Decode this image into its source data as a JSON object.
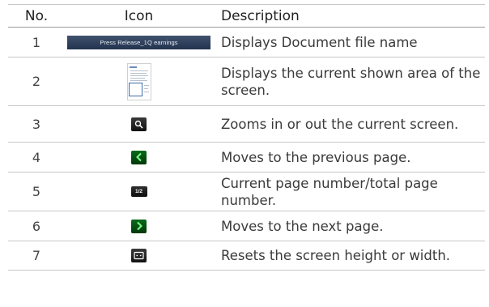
{
  "headers": {
    "no": "No.",
    "icon": "Icon",
    "description": "Description"
  },
  "rows": [
    {
      "no": "1",
      "icon": "document-title-bar-icon",
      "icon_text": "Press Release_1Q earnings",
      "description": "Displays Document file name"
    },
    {
      "no": "2",
      "icon": "page-thumbnail-icon",
      "description": "Displays the current shown area of the screen."
    },
    {
      "no": "3",
      "icon": "zoom-magnifier-icon",
      "description": "Zooms in or out the current screen."
    },
    {
      "no": "4",
      "icon": "previous-page-icon",
      "description": "Moves to the previous page."
    },
    {
      "no": "5",
      "icon": "page-number-icon",
      "icon_text": "1/2",
      "description": "Current page number/total page number."
    },
    {
      "no": "6",
      "icon": "next-page-icon",
      "description": "Moves to the next page."
    },
    {
      "no": "7",
      "icon": "fit-screen-icon",
      "description": "Resets the screen height or width."
    }
  ],
  "colors": {
    "title_bar": "#2f405c",
    "green_button": "#05501a",
    "dark_button": "#1e1e1e",
    "rule": "#c8c8c8"
  }
}
